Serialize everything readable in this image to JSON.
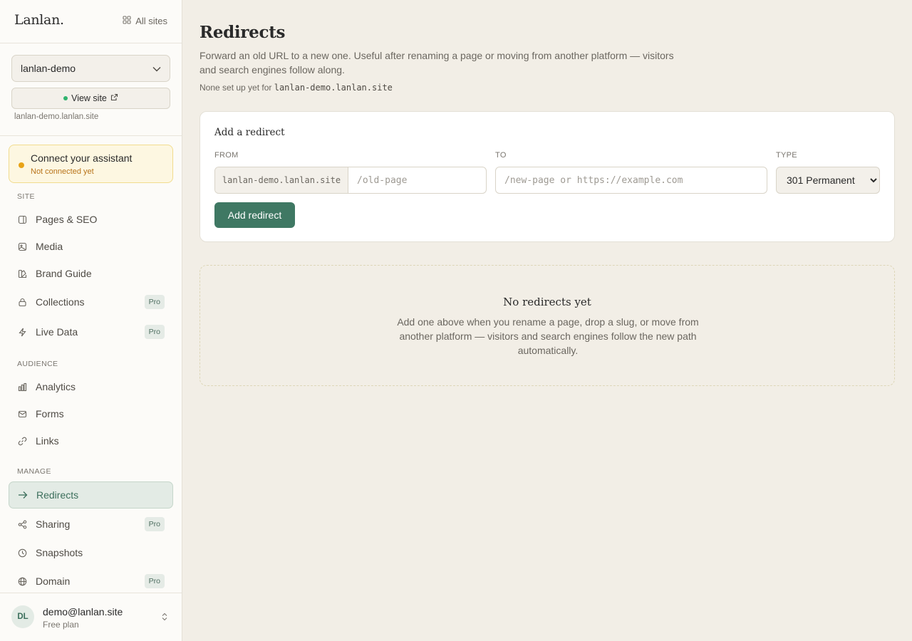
{
  "sidebar": {
    "brand": "Lanlan.",
    "all_sites": "All sites",
    "site_select": "lanlan-demo",
    "view_site": "View site",
    "site_domain": "lanlan-demo.lanlan.site",
    "assistant": {
      "title": "Connect your assistant",
      "status": "Not connected yet"
    },
    "sections": {
      "site": "SITE",
      "audience": "AUDIENCE",
      "manage": "MANAGE"
    },
    "items": {
      "pages_seo": {
        "label": "Pages & SEO"
      },
      "media": {
        "label": "Media"
      },
      "brand_guide": {
        "label": "Brand Guide"
      },
      "collections": {
        "label": "Collections",
        "badge": "Pro"
      },
      "live_data": {
        "label": "Live Data",
        "badge": "Pro"
      },
      "analytics": {
        "label": "Analytics"
      },
      "forms": {
        "label": "Forms"
      },
      "links": {
        "label": "Links"
      },
      "redirects": {
        "label": "Redirects"
      },
      "sharing": {
        "label": "Sharing",
        "badge": "Pro"
      },
      "snapshots": {
        "label": "Snapshots"
      },
      "domain": {
        "label": "Domain",
        "badge": "Pro"
      }
    },
    "user": {
      "initials": "DL",
      "email": "demo@lanlan.site",
      "plan": "Free plan"
    }
  },
  "main": {
    "title": "Redirects",
    "description": "Forward an old URL to a new one. Useful after renaming a page or moving from another platform — visitors and search engines follow along.",
    "note_prefix": "None set up yet for ",
    "note_domain": "lanlan-demo.lanlan.site",
    "form": {
      "title": "Add a redirect",
      "from_label": "FROM",
      "from_prefix": "lanlan-demo.lanlan.site",
      "from_placeholder": "/old-page",
      "to_label": "TO",
      "to_placeholder": "/new-page or https://example.com",
      "type_label": "TYPE",
      "type_selected": "301 Permanent",
      "submit": "Add redirect"
    },
    "empty": {
      "title": "No redirects yet",
      "text": "Add one above when you rename a page, drop a slug, or move from another platform — visitors and search engines follow the new path automatically."
    }
  },
  "colors": {
    "accent": "#3f7863",
    "background": "#f2eee6",
    "sidebar": "#fcfbf8",
    "status_green": "#2fb36e",
    "status_amber": "#e8a317"
  }
}
